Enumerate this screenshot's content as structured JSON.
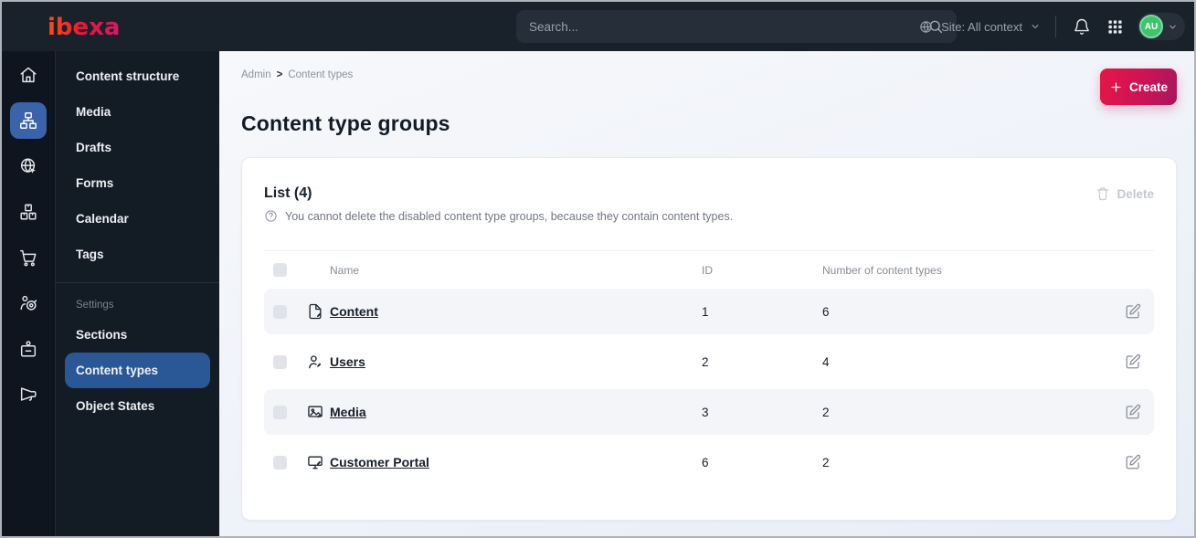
{
  "topbar": {
    "logo_text": "ibexa",
    "search": {
      "placeholder": "Search...",
      "icon": "search-icon"
    },
    "site_switcher": {
      "icon": "globe-icon",
      "label": "Site: All context",
      "chevron": "chevron-down-icon"
    },
    "icons": [
      "bell-icon",
      "app-grid-icon"
    ],
    "user": {
      "initials": "AU",
      "chevron": "chevron-down-icon"
    }
  },
  "sidebar": {
    "rail_icons": [
      "home-icon",
      "content-tree-icon",
      "site-globe-icon",
      "products-icon",
      "cart-icon",
      "target-audience-icon",
      "badge-icon",
      "megaphone-icon"
    ],
    "active_rail_icon": "content-tree-icon",
    "items": [
      {
        "label": "Content structure"
      },
      {
        "label": "Media"
      },
      {
        "label": "Drafts"
      },
      {
        "label": "Forms"
      },
      {
        "label": "Calendar"
      },
      {
        "label": "Tags"
      }
    ],
    "settings_label": "Settings",
    "settings_items": [
      {
        "label": "Sections"
      },
      {
        "label": "Content types",
        "active": true
      },
      {
        "label": "Object States"
      }
    ]
  },
  "main": {
    "breadcrumb": {
      "items": [
        "Admin",
        "Content types"
      ],
      "separator": ">"
    },
    "create_button": {
      "label": "Create",
      "icon": "plus-icon"
    },
    "page_title": "Content type groups",
    "panel": {
      "list_title": "List (4)",
      "info_icon": "help-icon",
      "info_text": "You cannot delete the disabled content type groups, because they contain content types.",
      "delete_button": {
        "label": "Delete",
        "icon": "trash-icon",
        "disabled": true
      },
      "table": {
        "columns": {
          "name": "Name",
          "id": "ID",
          "count": "Number of content types"
        },
        "rows": [
          {
            "icon": "document-icon",
            "name": "Content",
            "id": "1",
            "count": "6"
          },
          {
            "icon": "user-icon",
            "name": "Users",
            "id": "2",
            "count": "4"
          },
          {
            "icon": "image-icon",
            "name": "Media",
            "id": "3",
            "count": "2"
          },
          {
            "icon": "monitor-icon",
            "name": "Customer Portal",
            "id": "6",
            "count": "2"
          }
        ]
      }
    }
  },
  "colors": {
    "topbar_bg": "#19212b",
    "rail_bg": "#0e151e",
    "menu_bg": "#131b24",
    "active_icon_blue": "#3a63a9",
    "active_menu_blue": "#2a5795",
    "accent_gradient_start": "#e41746",
    "accent_gradient_end": "#a8175f",
    "avatar_green": "#3ec46d",
    "row_alt_bg": "#f4f5f8",
    "link_color": "#161f2a"
  }
}
